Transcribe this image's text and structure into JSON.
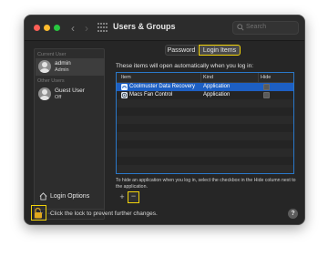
{
  "window": {
    "title": "Users & Groups",
    "search_placeholder": "Search"
  },
  "sidebar": {
    "current_user_header": "Current User",
    "current_user": {
      "name": "admin",
      "role": "Admin"
    },
    "other_users_header": "Other Users",
    "other_users": [
      {
        "name": "Guest User",
        "status": "Off"
      }
    ],
    "login_options_label": "Login Options",
    "add_label": "+",
    "remove_label": "−"
  },
  "tabs": {
    "password": "Password",
    "login_items": "Login Items"
  },
  "login_items": {
    "description": "These items will open automatically when you log in:",
    "columns": {
      "item": "Item",
      "kind": "Kind",
      "hide": "Hide"
    },
    "rows": [
      {
        "item": "Coolmuster Data Recovery",
        "kind": "Application",
        "hide": false,
        "icon": "coolmuster-app-icon",
        "selected": true
      },
      {
        "item": "Macs Fan Control",
        "kind": "Application",
        "hide": false,
        "icon": "macs-fan-control-app-icon",
        "selected": false
      }
    ],
    "hint": "To hide an application when you log in, select the checkbox in the Hide column next to the application.",
    "add_label": "+",
    "remove_label": "−"
  },
  "footer": {
    "lock_message": "Click the lock to prevent further changes.",
    "help_label": "?"
  },
  "colors": {
    "highlight": "#f1d20b",
    "selection": "#1d5fc3",
    "table_border": "#2a78c9"
  }
}
